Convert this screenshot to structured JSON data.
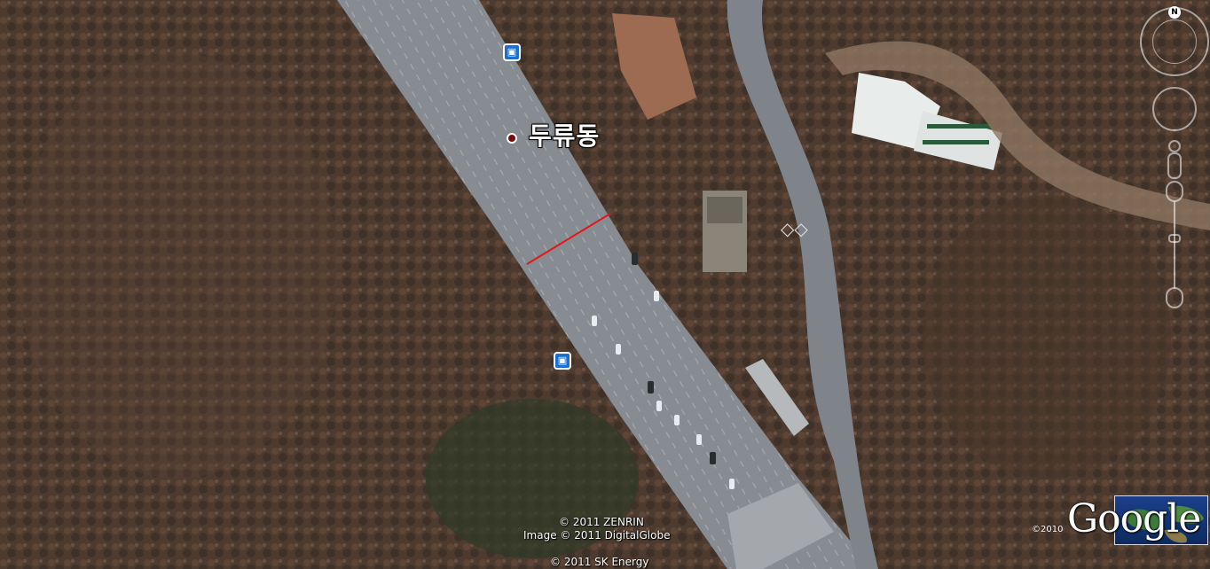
{
  "map": {
    "place_label": "두류동",
    "bus_stop_icon": "bus-stop-icon",
    "pin_icon": "place-marker-icon"
  },
  "attribution": {
    "line1": "© 2011 ZENRIN",
    "line2": "Image © 2011 DigitalGlobe",
    "line3": "© 2011 SK Energy",
    "year": "©2010",
    "logo": "Google"
  },
  "navigation": {
    "north_label": "N",
    "compass_icon": "compass-icon",
    "look_icon": "look-joystick-icon",
    "person_icon": "street-view-person-icon",
    "zoom_icon": "zoom-slider-icon"
  },
  "colors": {
    "road": "#8a8f96",
    "forest": "#4b3a2e",
    "marker": "#7a0a0a",
    "bus": "#1a6fd0",
    "measure_line": "#e01818"
  }
}
